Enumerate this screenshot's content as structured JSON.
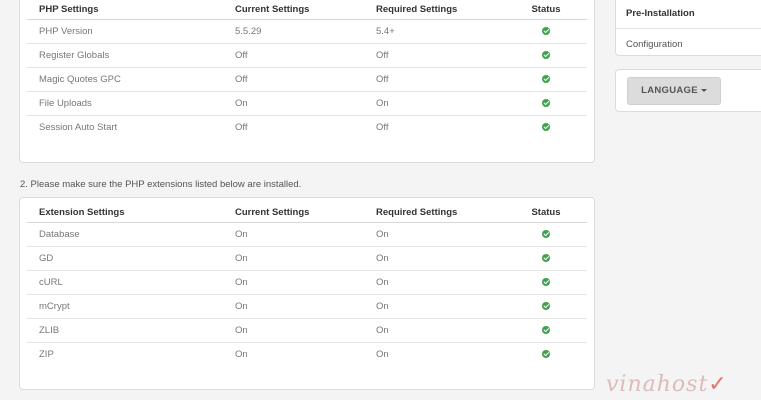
{
  "php_settings": {
    "headers": [
      "PHP Settings",
      "Current Settings",
      "Required Settings",
      "Status"
    ],
    "rows": [
      {
        "name": "PHP Version",
        "current": "5.5.29",
        "required": "5.4+",
        "status": "ok"
      },
      {
        "name": "Register Globals",
        "current": "Off",
        "required": "Off",
        "status": "ok"
      },
      {
        "name": "Magic Quotes GPC",
        "current": "Off",
        "required": "Off",
        "status": "ok"
      },
      {
        "name": "File Uploads",
        "current": "On",
        "required": "On",
        "status": "ok"
      },
      {
        "name": "Session Auto Start",
        "current": "Off",
        "required": "Off",
        "status": "ok"
      }
    ]
  },
  "extension_instruction": "2. Please make sure the PHP extensions listed below are installed.",
  "extension_settings": {
    "headers": [
      "Extension Settings",
      "Current Settings",
      "Required Settings",
      "Status"
    ],
    "rows": [
      {
        "name": "Database",
        "current": "On",
        "required": "On",
        "status": "ok"
      },
      {
        "name": "GD",
        "current": "On",
        "required": "On",
        "status": "ok"
      },
      {
        "name": "cURL",
        "current": "On",
        "required": "On",
        "status": "ok"
      },
      {
        "name": "mCrypt",
        "current": "On",
        "required": "On",
        "status": "ok"
      },
      {
        "name": "ZLIB",
        "current": "On",
        "required": "On",
        "status": "ok"
      },
      {
        "name": "ZIP",
        "current": "On",
        "required": "On",
        "status": "ok"
      }
    ]
  },
  "steps": {
    "items": [
      {
        "label": "Pre-Installation",
        "active": true
      },
      {
        "label": "Configuration",
        "active": false
      }
    ]
  },
  "language_button": {
    "label": "LANGUAGE"
  },
  "watermark": {
    "text": "vinahost",
    "icon": "check-mark-icon"
  },
  "colors": {
    "status_ok": "#3fa34d",
    "button_bg": "#dcdcdc"
  }
}
